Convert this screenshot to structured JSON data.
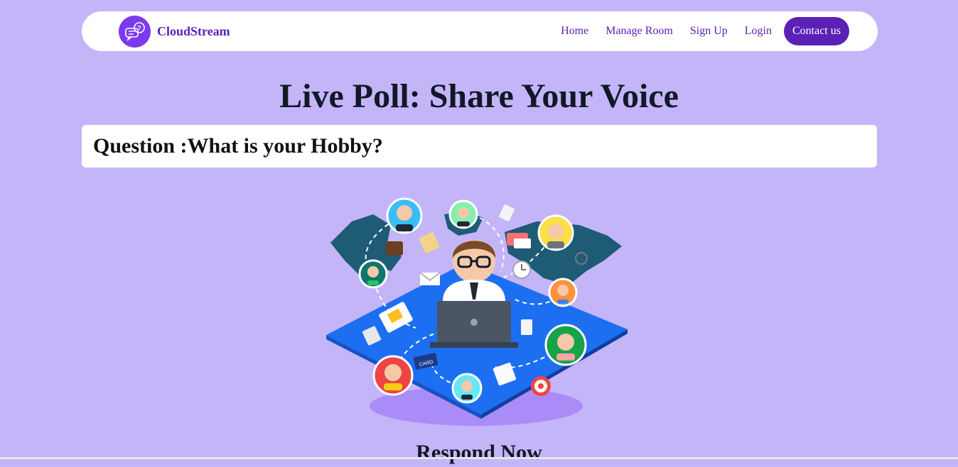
{
  "brand": {
    "name": "CloudStream",
    "logo_icon": "chat-question-icon"
  },
  "nav": {
    "links": [
      "Home",
      "Manage Room",
      "Sign Up",
      "Login"
    ],
    "contact_label": "Contact us"
  },
  "main": {
    "title": "Live Poll: Share Your Voice",
    "question_text": "Question :What is your Hobby?",
    "respond_title": "Respond Now"
  },
  "colors": {
    "page_bg": "#c4b5f9",
    "accent": "#5b21b6",
    "logo_bg": "#7c3aed"
  }
}
